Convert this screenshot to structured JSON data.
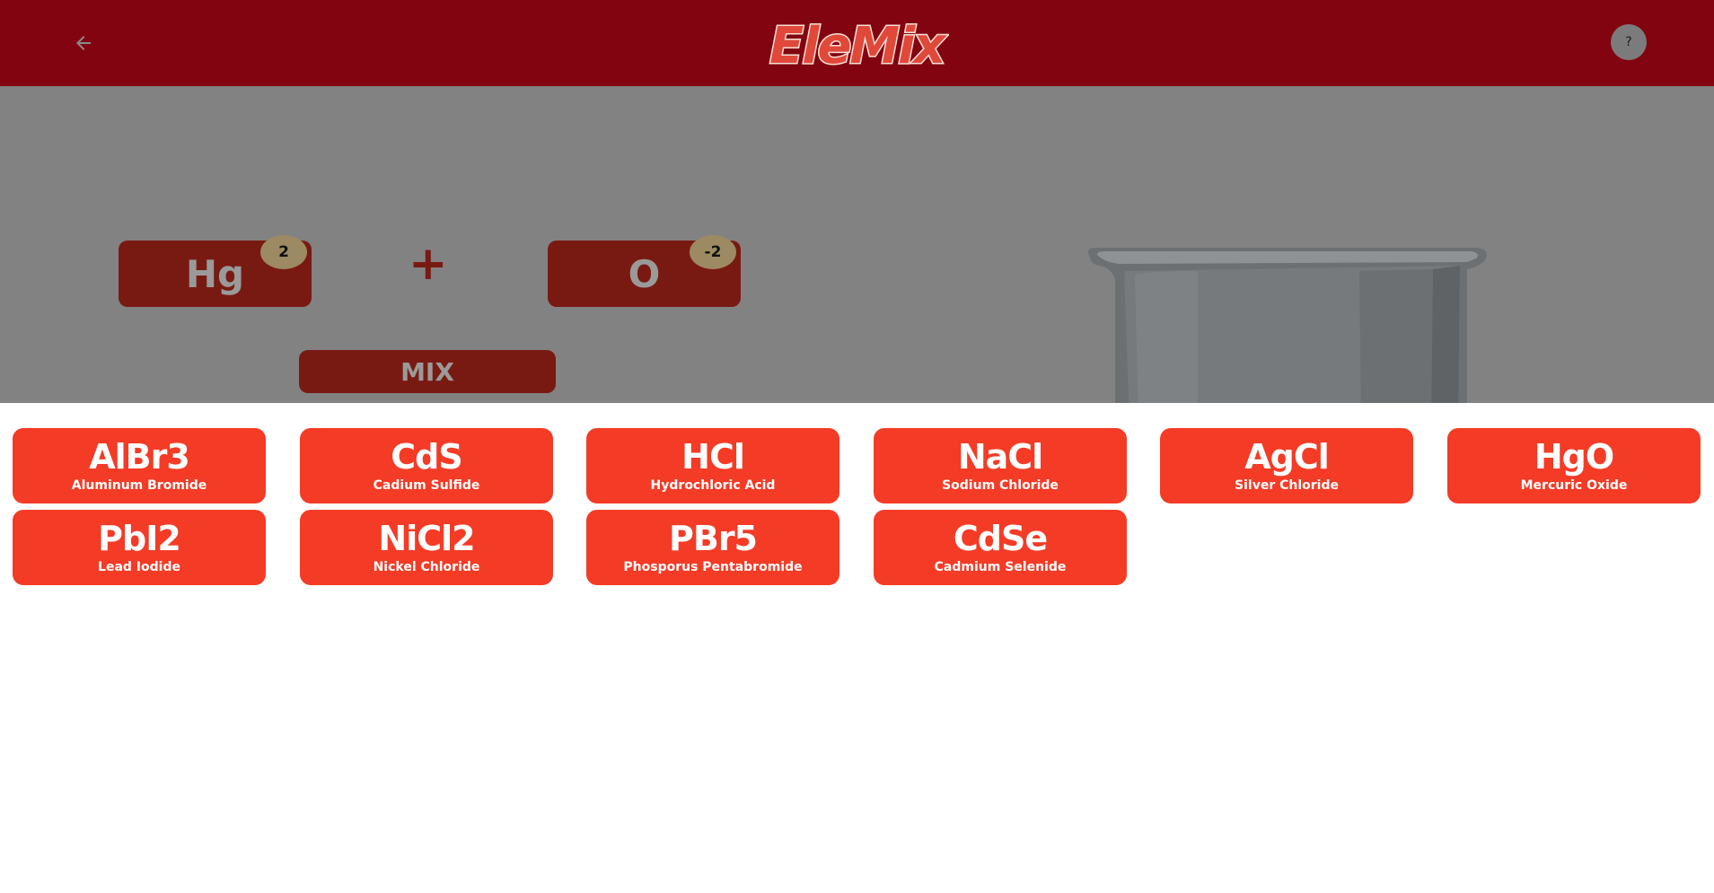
{
  "header": {
    "logo_text": "EleMix",
    "back_icon": "arrow-left-icon",
    "help_label": "?"
  },
  "reaction": {
    "element_a": {
      "symbol": "Hg",
      "charge": "2"
    },
    "operator": "+",
    "element_b": {
      "symbol": "O",
      "charge": "-2"
    },
    "mix_label": "MIX"
  },
  "compounds": [
    {
      "formula": "AlBr3",
      "name": "Aluminum Bromide"
    },
    {
      "formula": "CdS",
      "name": "Cadium Sulfide"
    },
    {
      "formula": "HCl",
      "name": "Hydrochloric Acid"
    },
    {
      "formula": "NaCl",
      "name": "Sodium Chloride"
    },
    {
      "formula": "AgCl",
      "name": "Silver Chloride"
    },
    {
      "formula": "HgO",
      "name": "Mercuric Oxide"
    },
    {
      "formula": "PbI2",
      "name": "Lead Iodide"
    },
    {
      "formula": "NiCl2",
      "name": "Nickel Chloride"
    },
    {
      "formula": "PBr5",
      "name": "Phosporus Pentabromide"
    },
    {
      "formula": "CdSe",
      "name": "Cadmium Selenide"
    }
  ],
  "colors": {
    "header": "#820410",
    "overlay": "#828282",
    "card": "#f43b26",
    "card_dim": "#791a12"
  }
}
